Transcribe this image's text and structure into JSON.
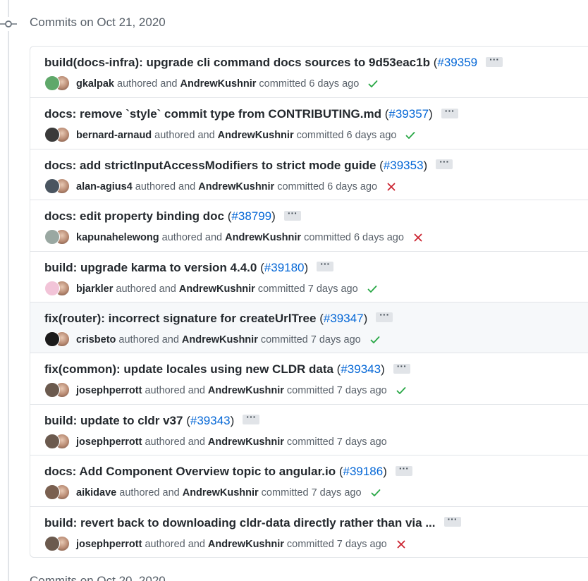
{
  "group": {
    "title": "Commits on Oct 21, 2020"
  },
  "next_group": {
    "title": "Commits on Oct 20, 2020"
  },
  "commits": [
    {
      "message": "build(docs-infra): upgrade cli command docs sources to 9d53eac1b",
      "pr_prefix": "(",
      "pr": "#39359",
      "pr_suffix": "",
      "author": "gkalpak",
      "authored_text": "authored and",
      "committer": "AndrewKushnir",
      "committed_text": "committed 6 days ago",
      "status": "success",
      "author_avatar_color": "#5fa86a"
    },
    {
      "message": "docs: remove `style` commit type from CONTRIBUTING.md",
      "pr_prefix": "(",
      "pr": "#39357",
      "pr_suffix": ")",
      "author": "bernard-arnaud",
      "authored_text": "authored and",
      "committer": "AndrewKushnir",
      "committed_text": "committed 6 days ago",
      "status": "success",
      "author_avatar_color": "#3a3a3a"
    },
    {
      "message": "docs: add strictInputAccessModifiers to strict mode guide",
      "pr_prefix": "(",
      "pr": "#39353",
      "pr_suffix": ")",
      "author": "alan-agius4",
      "authored_text": "authored and",
      "committer": "AndrewKushnir",
      "committed_text": "committed 6 days ago",
      "status": "failure",
      "author_avatar_color": "#4a5560"
    },
    {
      "message": "docs: edit property binding doc",
      "pr_prefix": "(",
      "pr": "#38799",
      "pr_suffix": ")",
      "author": "kapunahelewong",
      "authored_text": "authored and",
      "committer": "AndrewKushnir",
      "committed_text": "committed 6 days ago",
      "status": "failure",
      "author_avatar_color": "#9aa8a2"
    },
    {
      "message": "build: upgrade karma to version 4.4.0",
      "pr_prefix": "(",
      "pr": "#39180",
      "pr_suffix": ")",
      "author": "bjarkler",
      "authored_text": "authored and",
      "committer": "AndrewKushnir",
      "committed_text": "committed 7 days ago",
      "status": "success",
      "author_avatar_color": "#f2c4d8"
    },
    {
      "message": "fix(router): incorrect signature for createUrlTree",
      "pr_prefix": "(",
      "pr": "#39347",
      "pr_suffix": ")",
      "author": "crisbeto",
      "authored_text": "authored and",
      "committer": "AndrewKushnir",
      "committed_text": "committed 7 days ago",
      "status": "success",
      "author_avatar_color": "#1b1b1b",
      "hovered": true
    },
    {
      "message": "fix(common): update locales using new CLDR data",
      "pr_prefix": "(",
      "pr": "#39343",
      "pr_suffix": ")",
      "author": "josephperrott",
      "authored_text": "authored and",
      "committer": "AndrewKushnir",
      "committed_text": "committed 7 days ago",
      "status": "success",
      "author_avatar_color": "#6b5a4e"
    },
    {
      "message": "build: update to cldr v37",
      "pr_prefix": "(",
      "pr": "#39343",
      "pr_suffix": ")",
      "author": "josephperrott",
      "authored_text": "authored and",
      "committer": "AndrewKushnir",
      "committed_text": "committed 7 days ago",
      "status": "none",
      "author_avatar_color": "#6b5a4e"
    },
    {
      "message": "docs: Add Component Overview topic to angular.io",
      "pr_prefix": "(",
      "pr": "#39186",
      "pr_suffix": ")",
      "author": "aikidave",
      "authored_text": "authored and",
      "committer": "AndrewKushnir",
      "committed_text": "committed 7 days ago",
      "status": "success",
      "author_avatar_color": "#7a6050"
    },
    {
      "message": "build: revert back to downloading cldr-data directly rather than via ...",
      "pr_prefix": "",
      "pr": "",
      "pr_suffix": "",
      "author": "josephperrott",
      "authored_text": "authored and",
      "committer": "AndrewKushnir",
      "committed_text": "committed 7 days ago",
      "status": "failure",
      "author_avatar_color": "#6b5a4e"
    }
  ],
  "colors": {
    "link": "#0366d6",
    "success": "#28a745",
    "failure": "#cb2431",
    "muted": "#586069",
    "border": "#e1e4e8"
  },
  "icons": {
    "timeline": "git-commit-icon",
    "success": "check-icon",
    "failure": "x-icon",
    "more": "ellipsis-icon"
  }
}
